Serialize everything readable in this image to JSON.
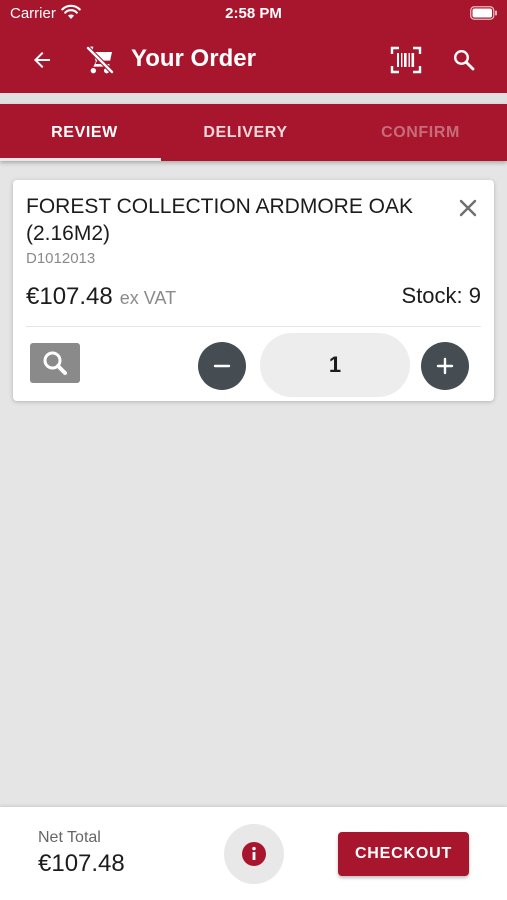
{
  "status_bar": {
    "carrier": "Carrier",
    "time": "2:58 PM",
    "icons": [
      "wifi-icon",
      "battery-icon"
    ]
  },
  "header": {
    "title": "Your Order",
    "icons": [
      "back-arrow-icon",
      "cart-off-icon",
      "barcode-scan-icon",
      "search-icon"
    ]
  },
  "tabs": [
    {
      "label": "REVIEW",
      "state": "active"
    },
    {
      "label": "DELIVERY",
      "state": "inactive"
    },
    {
      "label": "CONFIRM",
      "state": "disabled"
    }
  ],
  "order_items": [
    {
      "name": "FOREST COLLECTION ARDMORE OAK (2.16M2)",
      "code": "D1012013",
      "price": "€107.48",
      "vat_note": "ex VAT",
      "stock": "Stock: 9",
      "quantity": "1",
      "icons": [
        "close-icon",
        "zoom-icon",
        "minus-icon",
        "plus-icon"
      ]
    }
  ],
  "footer": {
    "net_total_label": "Net Total",
    "net_total_value": "€107.48",
    "checkout_label": "CHECKOUT",
    "icons": [
      "info-icon"
    ]
  },
  "colors": {
    "brand": "#a8162e",
    "background": "#e5e5e5",
    "stepper_button": "#454c52"
  }
}
